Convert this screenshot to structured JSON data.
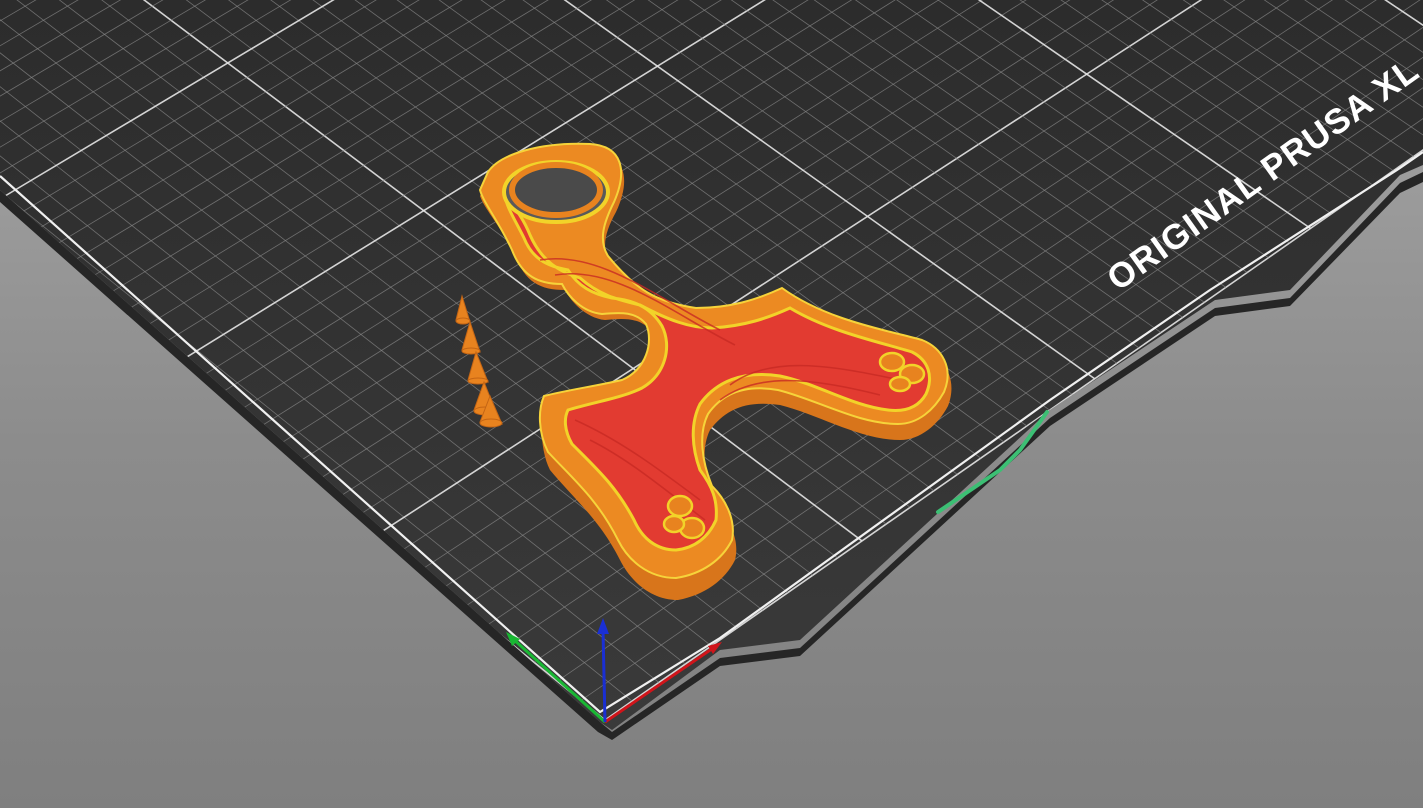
{
  "viewport": {
    "bed_label": "ORIGINAL PRUSA XL"
  },
  "colors": {
    "background_top": "#a6a6a6",
    "background_bottom": "#7f7f7f",
    "bed_surface": "#323232",
    "bed_edge": "#262626",
    "grid_fine": "#8a8a8a",
    "grid_major": "#e6e6e6",
    "model_orange": "#e8831f",
    "model_infill_red": "#e23b31",
    "model_perimeter_yellow": "#f2d329",
    "axis_x": "#d0141a",
    "axis_y": "#19b733",
    "axis_z": "#1a2fd4",
    "travel_green": "#3cbf74"
  },
  "icons": {
    "axis_gizmo": "xyz-axes-icon"
  }
}
